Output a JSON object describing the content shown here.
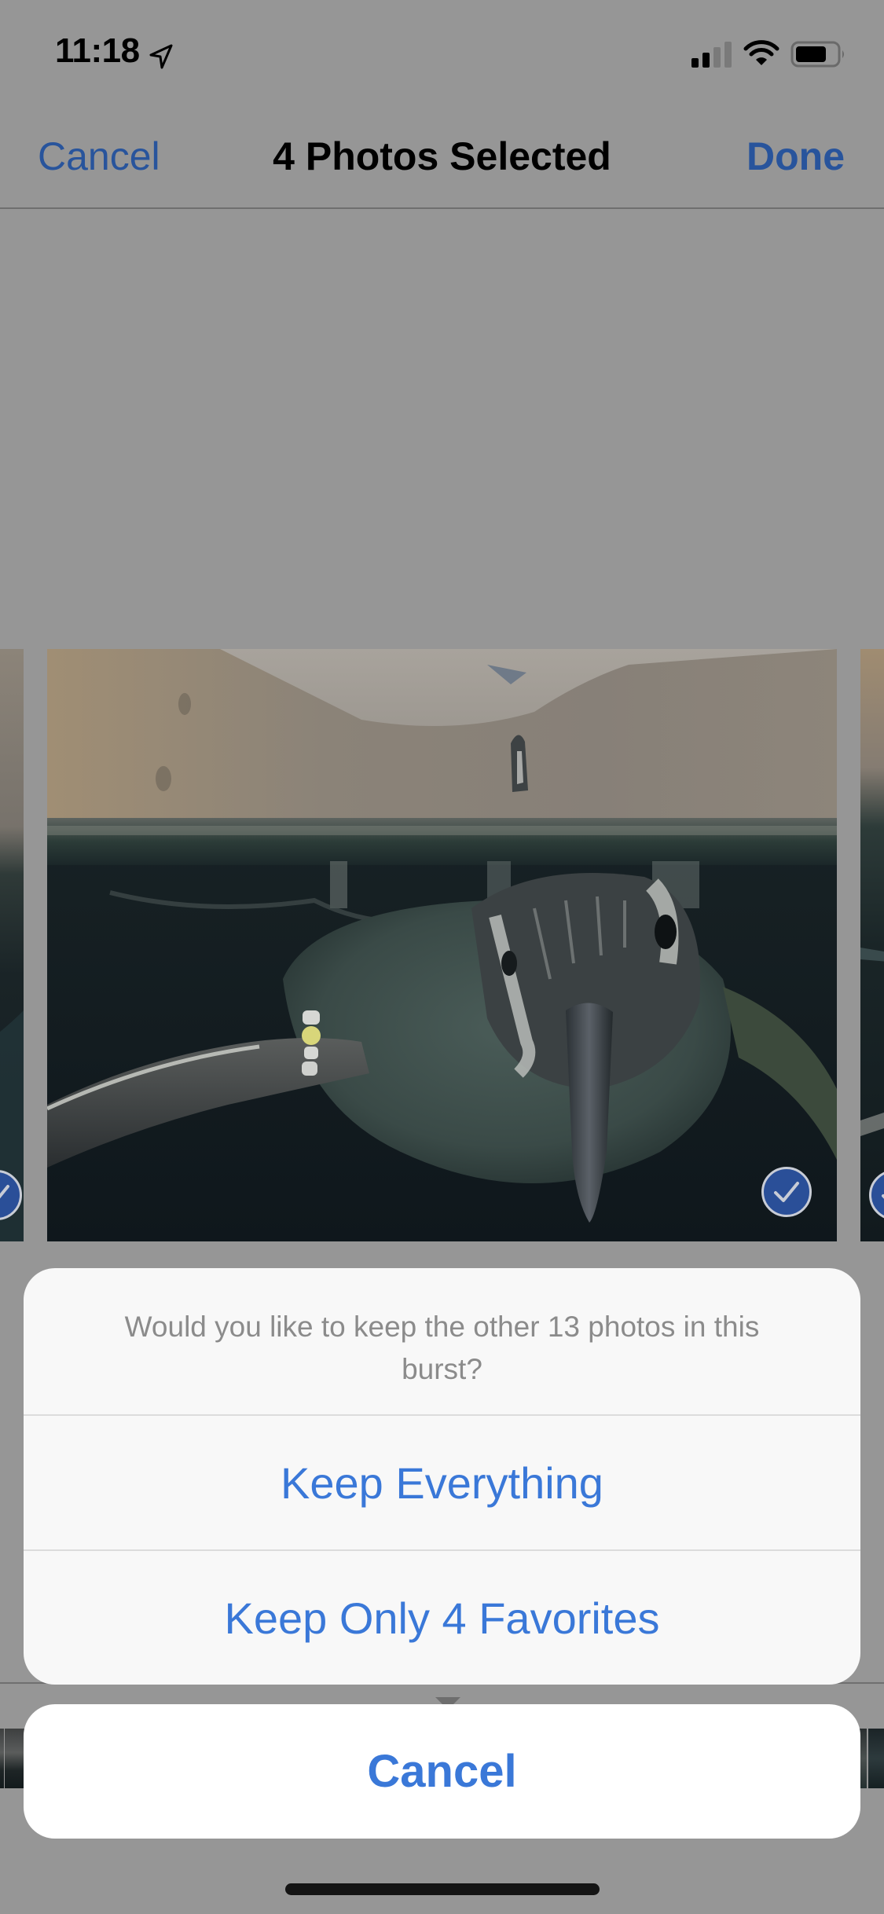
{
  "status_bar": {
    "time": "11:18",
    "location_icon": "location-arrow-icon",
    "signal_bars_active": 2,
    "signal_bars_total": 4,
    "battery_level": 0.75
  },
  "nav": {
    "cancel_label": "Cancel",
    "title": "4 Photos Selected",
    "done_label": "Done"
  },
  "carousel": {
    "photos": [
      {
        "position": "previous",
        "selected": true
      },
      {
        "position": "current",
        "selected": true,
        "subject": "penguin swimming underwater"
      },
      {
        "position": "next",
        "selected": true
      }
    ],
    "selection_icon": "checkmark-circle-icon",
    "accent_color": "#2a4f98"
  },
  "action_sheet": {
    "message": "Would you like to keep the other 13 photos in this burst?",
    "actions": [
      {
        "label": "Keep Everything"
      },
      {
        "label": "Keep Only 4 Favorites"
      }
    ],
    "cancel_label": "Cancel",
    "action_color": "#3a78d8"
  }
}
